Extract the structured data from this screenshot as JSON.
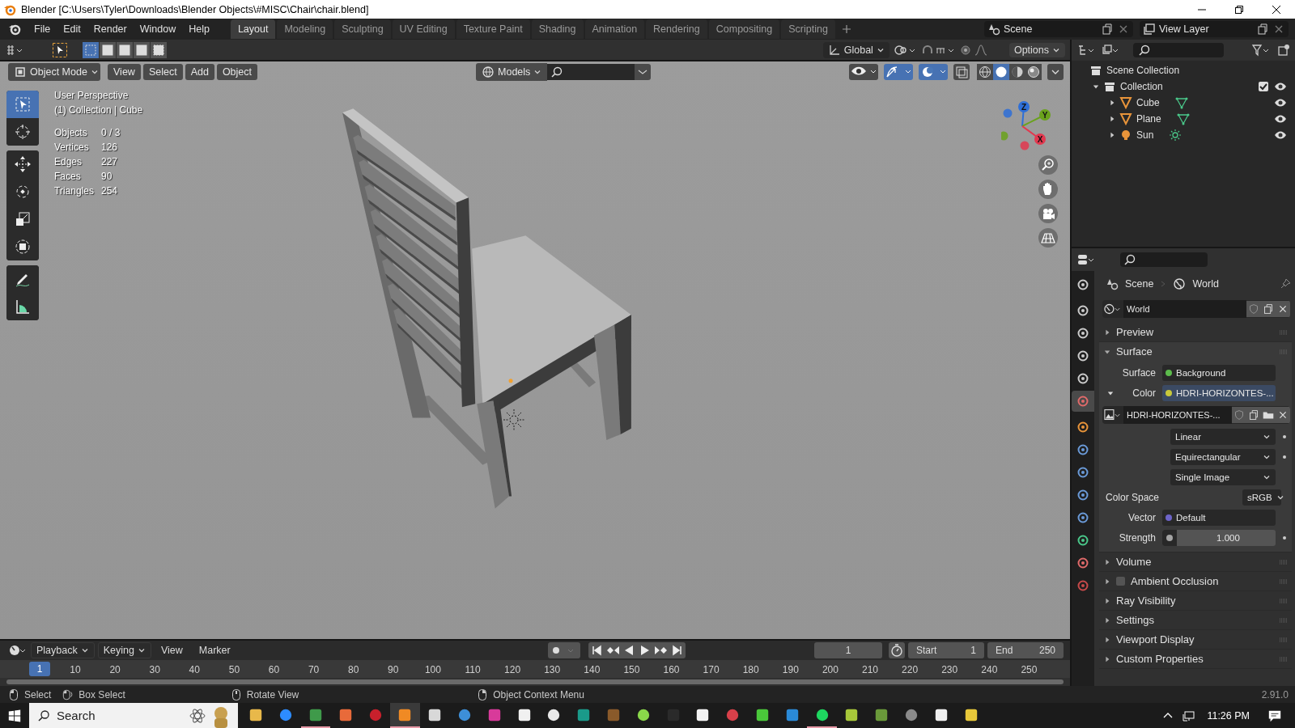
{
  "window": {
    "title": "Blender [C:\\Users\\Tyler\\Downloads\\Blender Objects\\#MISC\\Chair\\chair.blend]"
  },
  "menu": [
    "File",
    "Edit",
    "Render",
    "Window",
    "Help"
  ],
  "workspaces": [
    {
      "label": "Layout",
      "selected": true
    },
    {
      "label": "Modeling",
      "selected": false
    },
    {
      "label": "Sculpting",
      "selected": false
    },
    {
      "label": "UV Editing",
      "selected": false
    },
    {
      "label": "Texture Paint",
      "selected": false
    },
    {
      "label": "Shading",
      "selected": false
    },
    {
      "label": "Animation",
      "selected": false
    },
    {
      "label": "Rendering",
      "selected": false
    },
    {
      "label": "Compositing",
      "selected": false
    },
    {
      "label": "Scripting",
      "selected": false
    }
  ],
  "scene": "Scene",
  "view_layer": "View Layer",
  "tool_header": {
    "orientation": "Global",
    "options": "Options",
    "select_modes": [
      {
        "selected": true
      },
      {
        "selected": false
      },
      {
        "selected": false
      },
      {
        "selected": false
      },
      {
        "selected": false
      }
    ]
  },
  "viewport_header": {
    "mode": "Object Mode",
    "menus": [
      "View",
      "Select",
      "Add",
      "Object"
    ],
    "collection": "Models",
    "gizmos_on": true,
    "overlays_on": true,
    "shading": [
      {
        "selected": false
      },
      {
        "selected": true
      },
      {
        "selected": false
      },
      {
        "selected": false
      }
    ]
  },
  "viewport": {
    "info": [
      "User Perspective",
      "(1) Collection | Cube"
    ],
    "stats": [
      {
        "label": "Objects",
        "value": "0 / 3"
      },
      {
        "label": "Vertices",
        "value": "126"
      },
      {
        "label": "Edges",
        "value": "227"
      },
      {
        "label": "Faces",
        "value": "90"
      },
      {
        "label": "Triangles",
        "value": "254"
      }
    ],
    "tools": [
      {
        "selected": true
      },
      {
        "selected": false
      },
      {
        "selected": false
      },
      {
        "selected": false
      },
      {
        "selected": false
      },
      {
        "selected": false
      },
      {
        "selected": false
      },
      {
        "selected": false
      }
    ],
    "axes": [
      {
        "label": "Z",
        "color": "#2e6fd8"
      },
      {
        "label": "Y",
        "color": "#6aa21c"
      },
      {
        "label": "X",
        "color": "#e2384f"
      }
    ]
  },
  "outliner": {
    "root": "Scene Collection",
    "items": [
      {
        "label": "Collection",
        "kind": "collection",
        "expanded": true,
        "checked": true,
        "children": [
          {
            "label": "Cube",
            "kind": "mesh",
            "expanded": false,
            "checked": true
          },
          {
            "label": "Plane",
            "kind": "mesh",
            "expanded": false,
            "checked": true
          },
          {
            "label": "Sun",
            "kind": "light",
            "expanded": false,
            "checked": true
          }
        ]
      }
    ]
  },
  "properties": {
    "tabs": [
      {
        "selected": false
      },
      {
        "selected": false
      },
      {
        "selected": false
      },
      {
        "selected": false
      },
      {
        "selected": false
      },
      {
        "selected": true
      },
      {
        "selected": false
      },
      {
        "selected": false
      },
      {
        "selected": false
      },
      {
        "selected": false
      },
      {
        "selected": false
      },
      {
        "selected": false
      },
      {
        "selected": false
      },
      {
        "selected": false
      }
    ],
    "breadcrumb": [
      "Scene",
      "World"
    ],
    "datablock": "World",
    "panels": [
      {
        "label": "Preview",
        "kind": "plain",
        "expanded": false
      },
      {
        "label": "Surface",
        "kind": "surface",
        "expanded": true
      },
      {
        "label": "Volume",
        "kind": "plain",
        "expanded": false
      },
      {
        "label": "Ambient Occlusion",
        "kind": "toggle",
        "expanded": false,
        "checked": false
      },
      {
        "label": "Ray Visibility",
        "kind": "plain",
        "expanded": false
      },
      {
        "label": "Settings",
        "kind": "plain",
        "expanded": false
      },
      {
        "label": "Viewport Display",
        "kind": "plain",
        "expanded": false
      },
      {
        "label": "Custom Properties",
        "kind": "plain",
        "expanded": false
      }
    ],
    "surface_rows": [
      {
        "kind": "socket",
        "label": "Surface",
        "value": "Background",
        "color": "#5cbb4c"
      },
      {
        "kind": "socket",
        "label": "Color",
        "value": "HDRI-HORIZONTES-...",
        "color": "#c8c83a",
        "expanded": true
      },
      {
        "kind": "image",
        "value": "HDRI-HORIZONTES-..."
      },
      {
        "kind": "dropdown",
        "value": "Linear",
        "animatable": true
      },
      {
        "kind": "dropdown",
        "value": "Equirectangular",
        "animatable": true
      },
      {
        "kind": "dropdown",
        "value": "Single Image",
        "animatable": false
      },
      {
        "kind": "select",
        "label": "Color Space",
        "value": "sRGB"
      },
      {
        "kind": "socket",
        "label": "Vector",
        "value": "Default",
        "color": "#6d64c8"
      },
      {
        "kind": "number",
        "label": "Strength",
        "value": "1.000",
        "color": "#a3a3a3",
        "animatable": true
      }
    ]
  },
  "timeline": {
    "menus": [
      "Playback",
      "Keying",
      "View",
      "Marker"
    ],
    "current_frame": "1",
    "start_label": "Start",
    "start": "1",
    "end_label": "End",
    "end": "250",
    "playhead": "1",
    "ruler": [
      "10",
      "20",
      "30",
      "40",
      "50",
      "60",
      "70",
      "80",
      "90",
      "100",
      "110",
      "120",
      "130",
      "140",
      "150",
      "160",
      "170",
      "180",
      "190",
      "200",
      "210",
      "220",
      "230",
      "240",
      "250"
    ]
  },
  "status_bar": {
    "hints": [
      "Select",
      "Box Select",
      "Rotate View",
      "Object Context Menu"
    ],
    "version": "2.91.0"
  },
  "taskbar": {
    "search": {
      "placeholder": "Search"
    },
    "time": "11:26 PM",
    "apps": [
      {
        "color": "#e8b84a",
        "running": false,
        "selected": false
      },
      {
        "color": "#2d8cff",
        "running": false,
        "selected": false
      },
      {
        "color": "#3f9a4a",
        "running": true,
        "selected": false
      },
      {
        "color": "#e86a3a",
        "running": false,
        "selected": false
      },
      {
        "color": "#c8202c",
        "running": false,
        "selected": false
      },
      {
        "color": "#f08a24",
        "running": true,
        "selected": true
      },
      {
        "color": "#d8d8d8",
        "running": false,
        "selected": false
      },
      {
        "color": "#3d8fd8",
        "running": false,
        "selected": false
      },
      {
        "color": "#d83a9a",
        "running": false,
        "selected": false
      },
      {
        "color": "#f0f0f0",
        "running": false,
        "selected": false
      },
      {
        "color": "#e8e8e8",
        "running": false,
        "selected": false
      },
      {
        "color": "#1a9a8a",
        "running": false,
        "selected": false
      },
      {
        "color": "#8a5a2a",
        "running": false,
        "selected": false
      },
      {
        "color": "#8ad84a",
        "running": false,
        "selected": false
      },
      {
        "color": "#2a2a2a",
        "running": false,
        "selected": false
      },
      {
        "color": "#f4f4f4",
        "running": false,
        "selected": false
      },
      {
        "color": "#d8404a",
        "running": false,
        "selected": false
      },
      {
        "color": "#4ac83a",
        "running": false,
        "selected": false
      },
      {
        "color": "#2a8ad8",
        "running": false,
        "selected": false
      },
      {
        "color": "#1ed760",
        "running": true,
        "selected": false
      },
      {
        "color": "#a8c83a",
        "running": false,
        "selected": false
      },
      {
        "color": "#6a9a3a",
        "running": false,
        "selected": false
      },
      {
        "color": "#8a8a8a",
        "running": false,
        "selected": false
      },
      {
        "color": "#f0f0f0",
        "running": false,
        "selected": false
      },
      {
        "color": "#e8c83a",
        "running": false,
        "selected": false
      }
    ]
  }
}
